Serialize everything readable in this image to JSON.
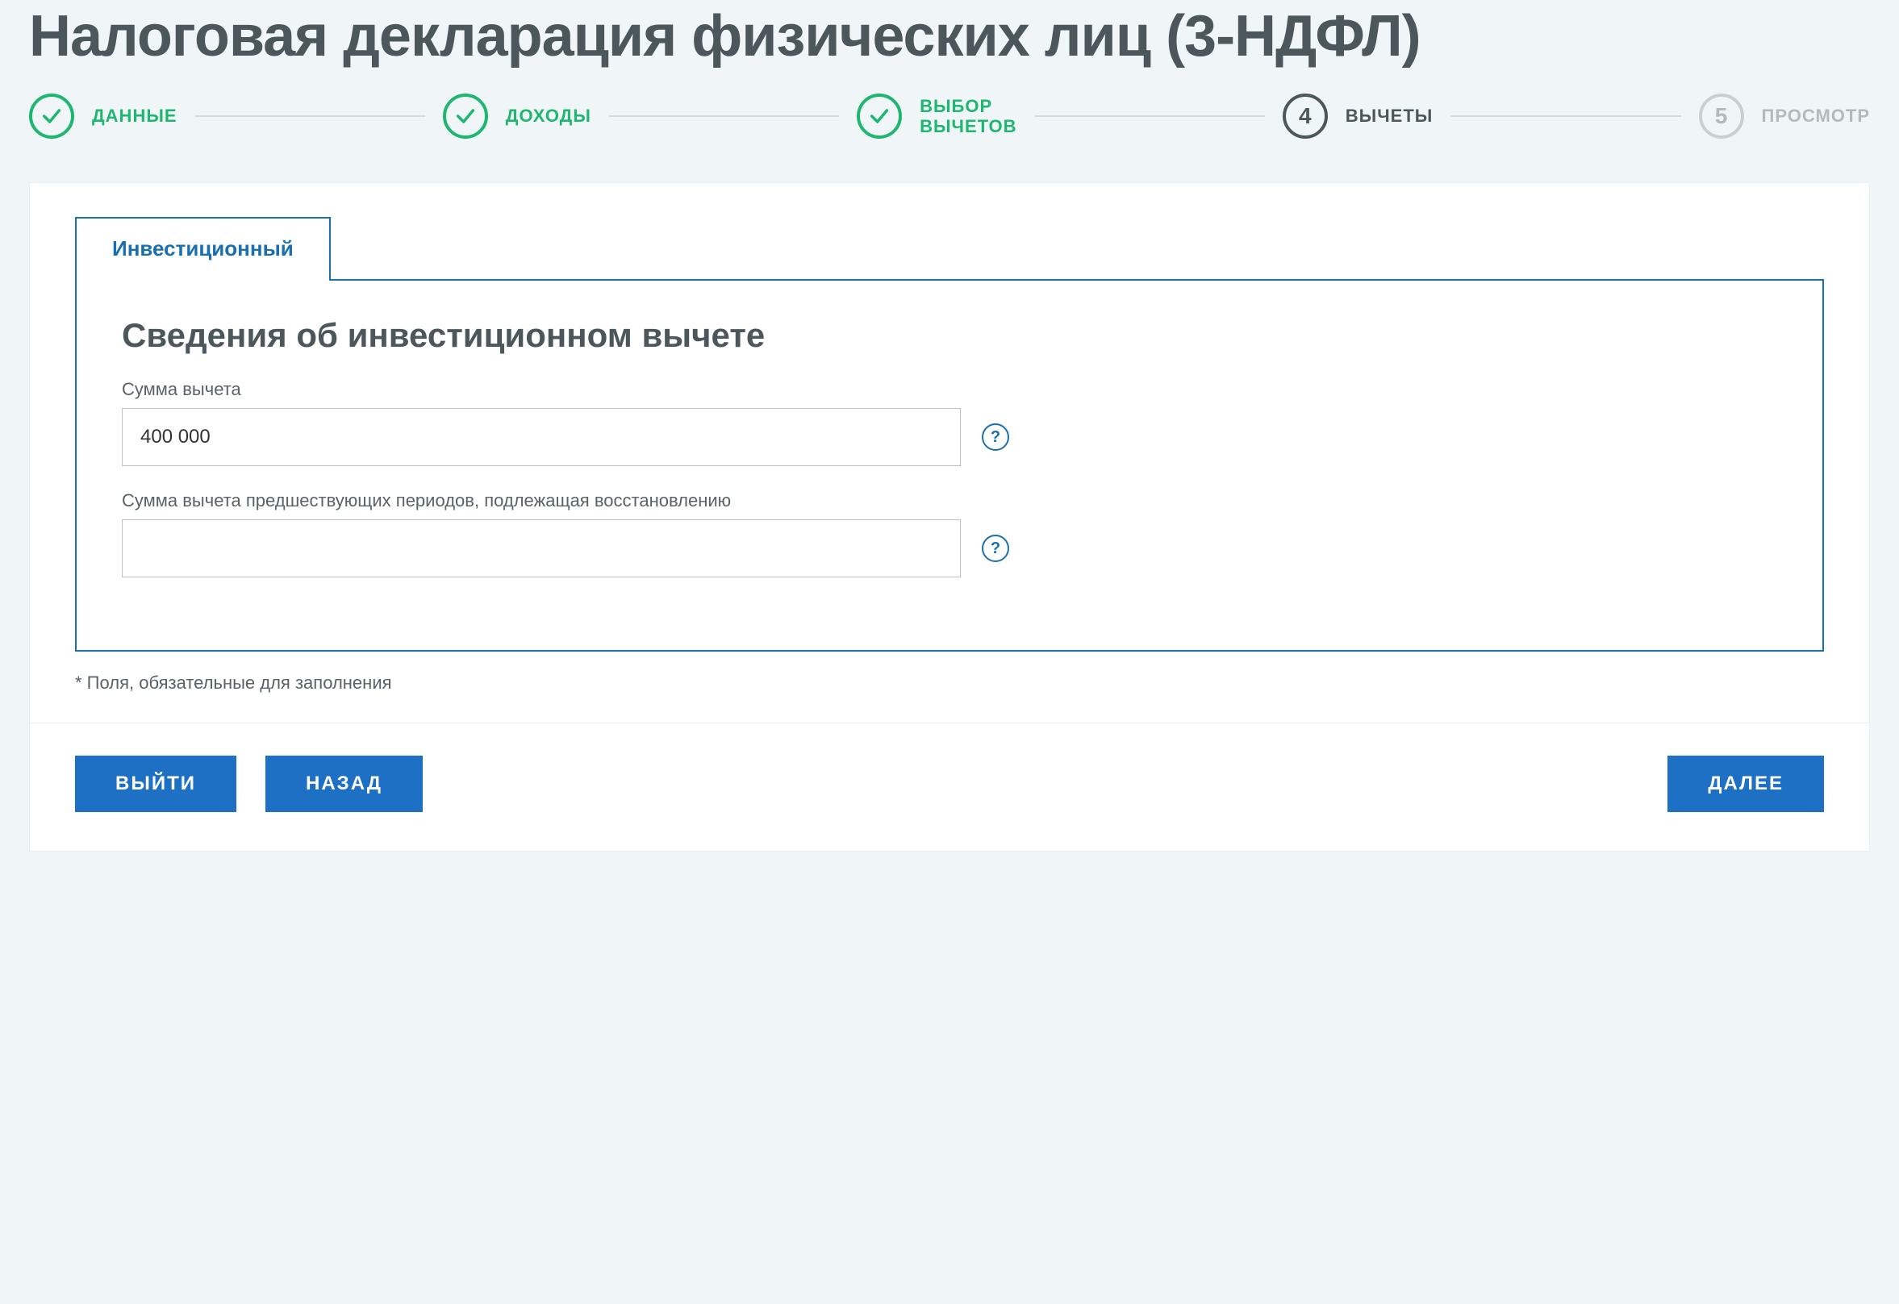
{
  "page": {
    "title": "Налоговая декларация физических лиц (3-НДФЛ)"
  },
  "stepper": {
    "steps": [
      {
        "label": "ДАННЫЕ",
        "state": "done"
      },
      {
        "label": "ДОХОДЫ",
        "state": "done"
      },
      {
        "label": "ВЫБОР\nВЫЧЕТОВ",
        "state": "done"
      },
      {
        "num": "4",
        "label": "ВЫЧЕТЫ",
        "state": "current"
      },
      {
        "num": "5",
        "label": "ПРОСМОТР",
        "state": "future"
      }
    ]
  },
  "tabs": {
    "active": {
      "label": "Инвестиционный"
    }
  },
  "form": {
    "heading": "Сведения об инвестиционном вычете",
    "fields": {
      "amount": {
        "label": "Сумма вычета",
        "value": "400 000"
      },
      "restore": {
        "label": "Сумма вычета предшествующих периодов, подлежащая восстановлению",
        "value": ""
      }
    },
    "help_glyph": "?",
    "required_note": "* Поля, обязательные для заполнения"
  },
  "buttons": {
    "exit": "ВЫЙТИ",
    "back": "НАЗАД",
    "next": "ДАЛЕЕ"
  }
}
